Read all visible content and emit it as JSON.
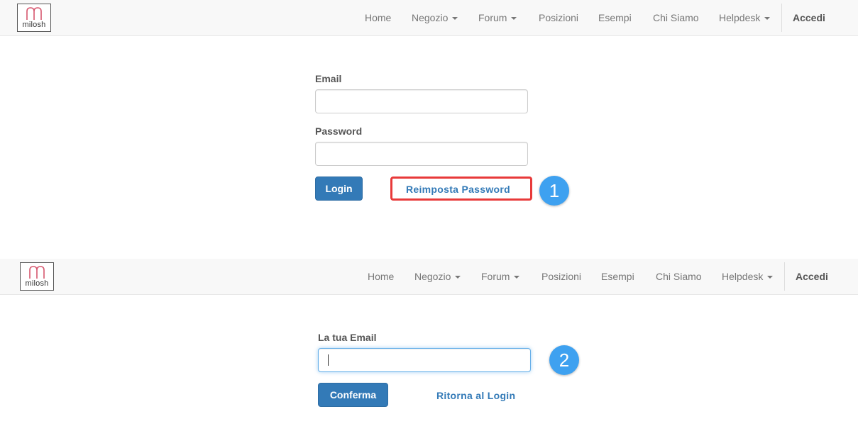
{
  "brand": {
    "logo_text": "milosh",
    "logo_color": "#d6566e"
  },
  "nav": {
    "items": [
      {
        "label": "Home",
        "dropdown": false
      },
      {
        "label": "Negozio",
        "dropdown": true
      },
      {
        "label": "Forum",
        "dropdown": true
      },
      {
        "label": "Posizioni",
        "dropdown": false
      },
      {
        "label": "Esempi",
        "dropdown": false
      },
      {
        "label": "Chi Siamo",
        "dropdown": false
      },
      {
        "label": "Helpdesk",
        "dropdown": true
      }
    ],
    "login": "Accedi"
  },
  "login_form": {
    "email_label": "Email",
    "email_value": "",
    "password_label": "Password",
    "password_value": "",
    "login_button": "Login",
    "reset_link": "Reimposta Password",
    "step_badge": "1"
  },
  "reset_form": {
    "email_label": "La tua Email",
    "email_value": "",
    "confirm_button": "Conferma",
    "back_link": "Ritorna al Login",
    "step_badge": "2"
  },
  "colors": {
    "primary": "#337ab7",
    "highlight": "#e83a3a",
    "badge": "#3ea1f0",
    "navbar_bg": "#f8f8f8"
  }
}
